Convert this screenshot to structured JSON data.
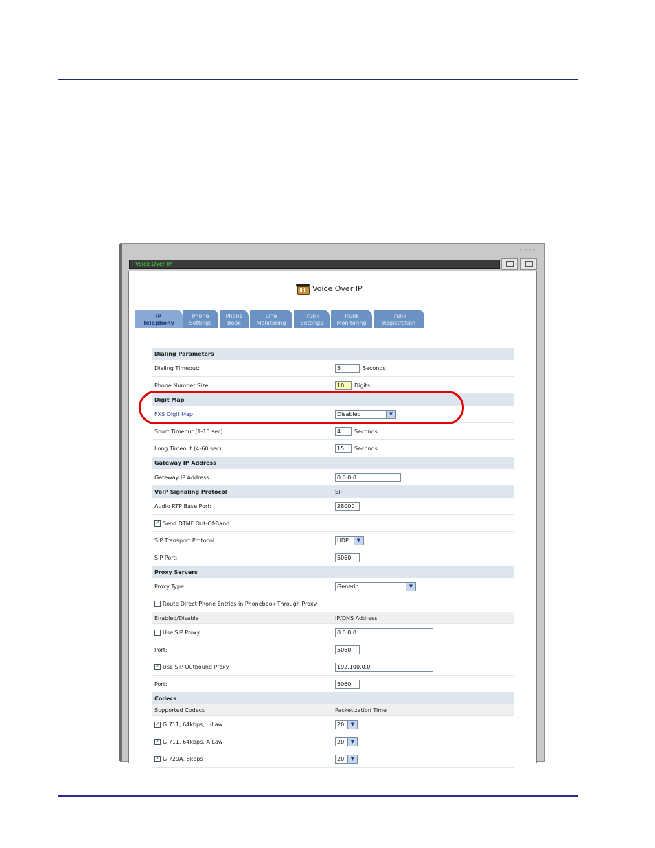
{
  "window": {
    "title_bar": "Voice Over IP",
    "page_title": "Voice Over IP"
  },
  "tabs": [
    {
      "line1": "IP",
      "line2": "Telephony",
      "active": true
    },
    {
      "line1": "Phone",
      "line2": "Settings"
    },
    {
      "line1": "Phone",
      "line2": "Book"
    },
    {
      "line1": "Line",
      "line2": "Monitoring"
    },
    {
      "line1": "Trunk",
      "line2": "Settings"
    },
    {
      "line1": "Trunk",
      "line2": "Monitoring"
    },
    {
      "line1": "Trunk",
      "line2": "Registration"
    }
  ],
  "form": {
    "dialing_parameters": "Dialing Parameters",
    "dialing_timeout": {
      "label": "Dialing Timeout:",
      "value": "5",
      "unit": "Seconds"
    },
    "phone_number_size": {
      "label": "Phone Number Size:",
      "value": "10",
      "unit": "Digits"
    },
    "digit_map": "Digit Map",
    "fxs_digit_map": {
      "label": "FXS Digit Map",
      "value": "Disabled"
    },
    "short_timeout": {
      "label": "Short Timeout (1-10 sec):",
      "value": "4",
      "unit": "Seconds"
    },
    "long_timeout": {
      "label": "Long Timeout (4-60 sec):",
      "value": "15",
      "unit": "Seconds"
    },
    "gateway_ip_address_header": "Gateway IP Address",
    "gateway_ip_address": {
      "label": "Gateway IP Address:",
      "value": "0.0.0.0"
    },
    "voip_signaling_protocol": {
      "label": "VoIP Signaling Protocol",
      "value": "SIP"
    },
    "audio_rtp_base_port": {
      "label": "Audio RTP Base Port:",
      "value": "28000"
    },
    "send_dtmf": {
      "label": "Send DTMF Out-Of-Band",
      "checked": true
    },
    "sip_transport_protocol": {
      "label": "SIP Transport Protocol:",
      "value": "UDP"
    },
    "sip_port": {
      "label": "SIP Port:",
      "value": "5060"
    },
    "proxy_servers": "Proxy Servers",
    "proxy_type": {
      "label": "Proxy Type:",
      "value": "Generic"
    },
    "route_direct": {
      "label": "Route Direct Phone Entries in Phonebook Through Proxy",
      "checked": false
    },
    "enabled_disable": {
      "label": "Enabled/Disable",
      "right": "IP/DNS Address"
    },
    "use_sip_proxy": {
      "label": "Use SIP Proxy",
      "checked": false,
      "value": "0.0.0.0"
    },
    "proxy_port": {
      "label": "Port:",
      "value": "5060"
    },
    "use_sip_outbound_proxy": {
      "label": "Use SIP Outbound Proxy",
      "checked": true,
      "value": "192.100.0.0"
    },
    "outbound_port": {
      "label": "Port:",
      "value": "5060"
    },
    "codecs": "Codecs",
    "supported_codecs": {
      "label": "Supported Codecs",
      "right": "Packetization Time"
    },
    "codec_list": [
      {
        "label": "G.711, 64kbps, u-Law",
        "checked": true,
        "value": "20"
      },
      {
        "label": "G.711, 64kbps, A-Law",
        "checked": true,
        "value": "20"
      },
      {
        "label": "G.729A, 8kbps",
        "checked": true,
        "value": "20"
      }
    ]
  },
  "colors": {
    "tab": "#6a93c4",
    "tab_active": "#88a9d4",
    "highlight_oval": "#e40000",
    "title_text": "#37e037"
  },
  "icons": [
    "phone-icon",
    "checkbox-checked-icon",
    "chevron-down-icon"
  ]
}
